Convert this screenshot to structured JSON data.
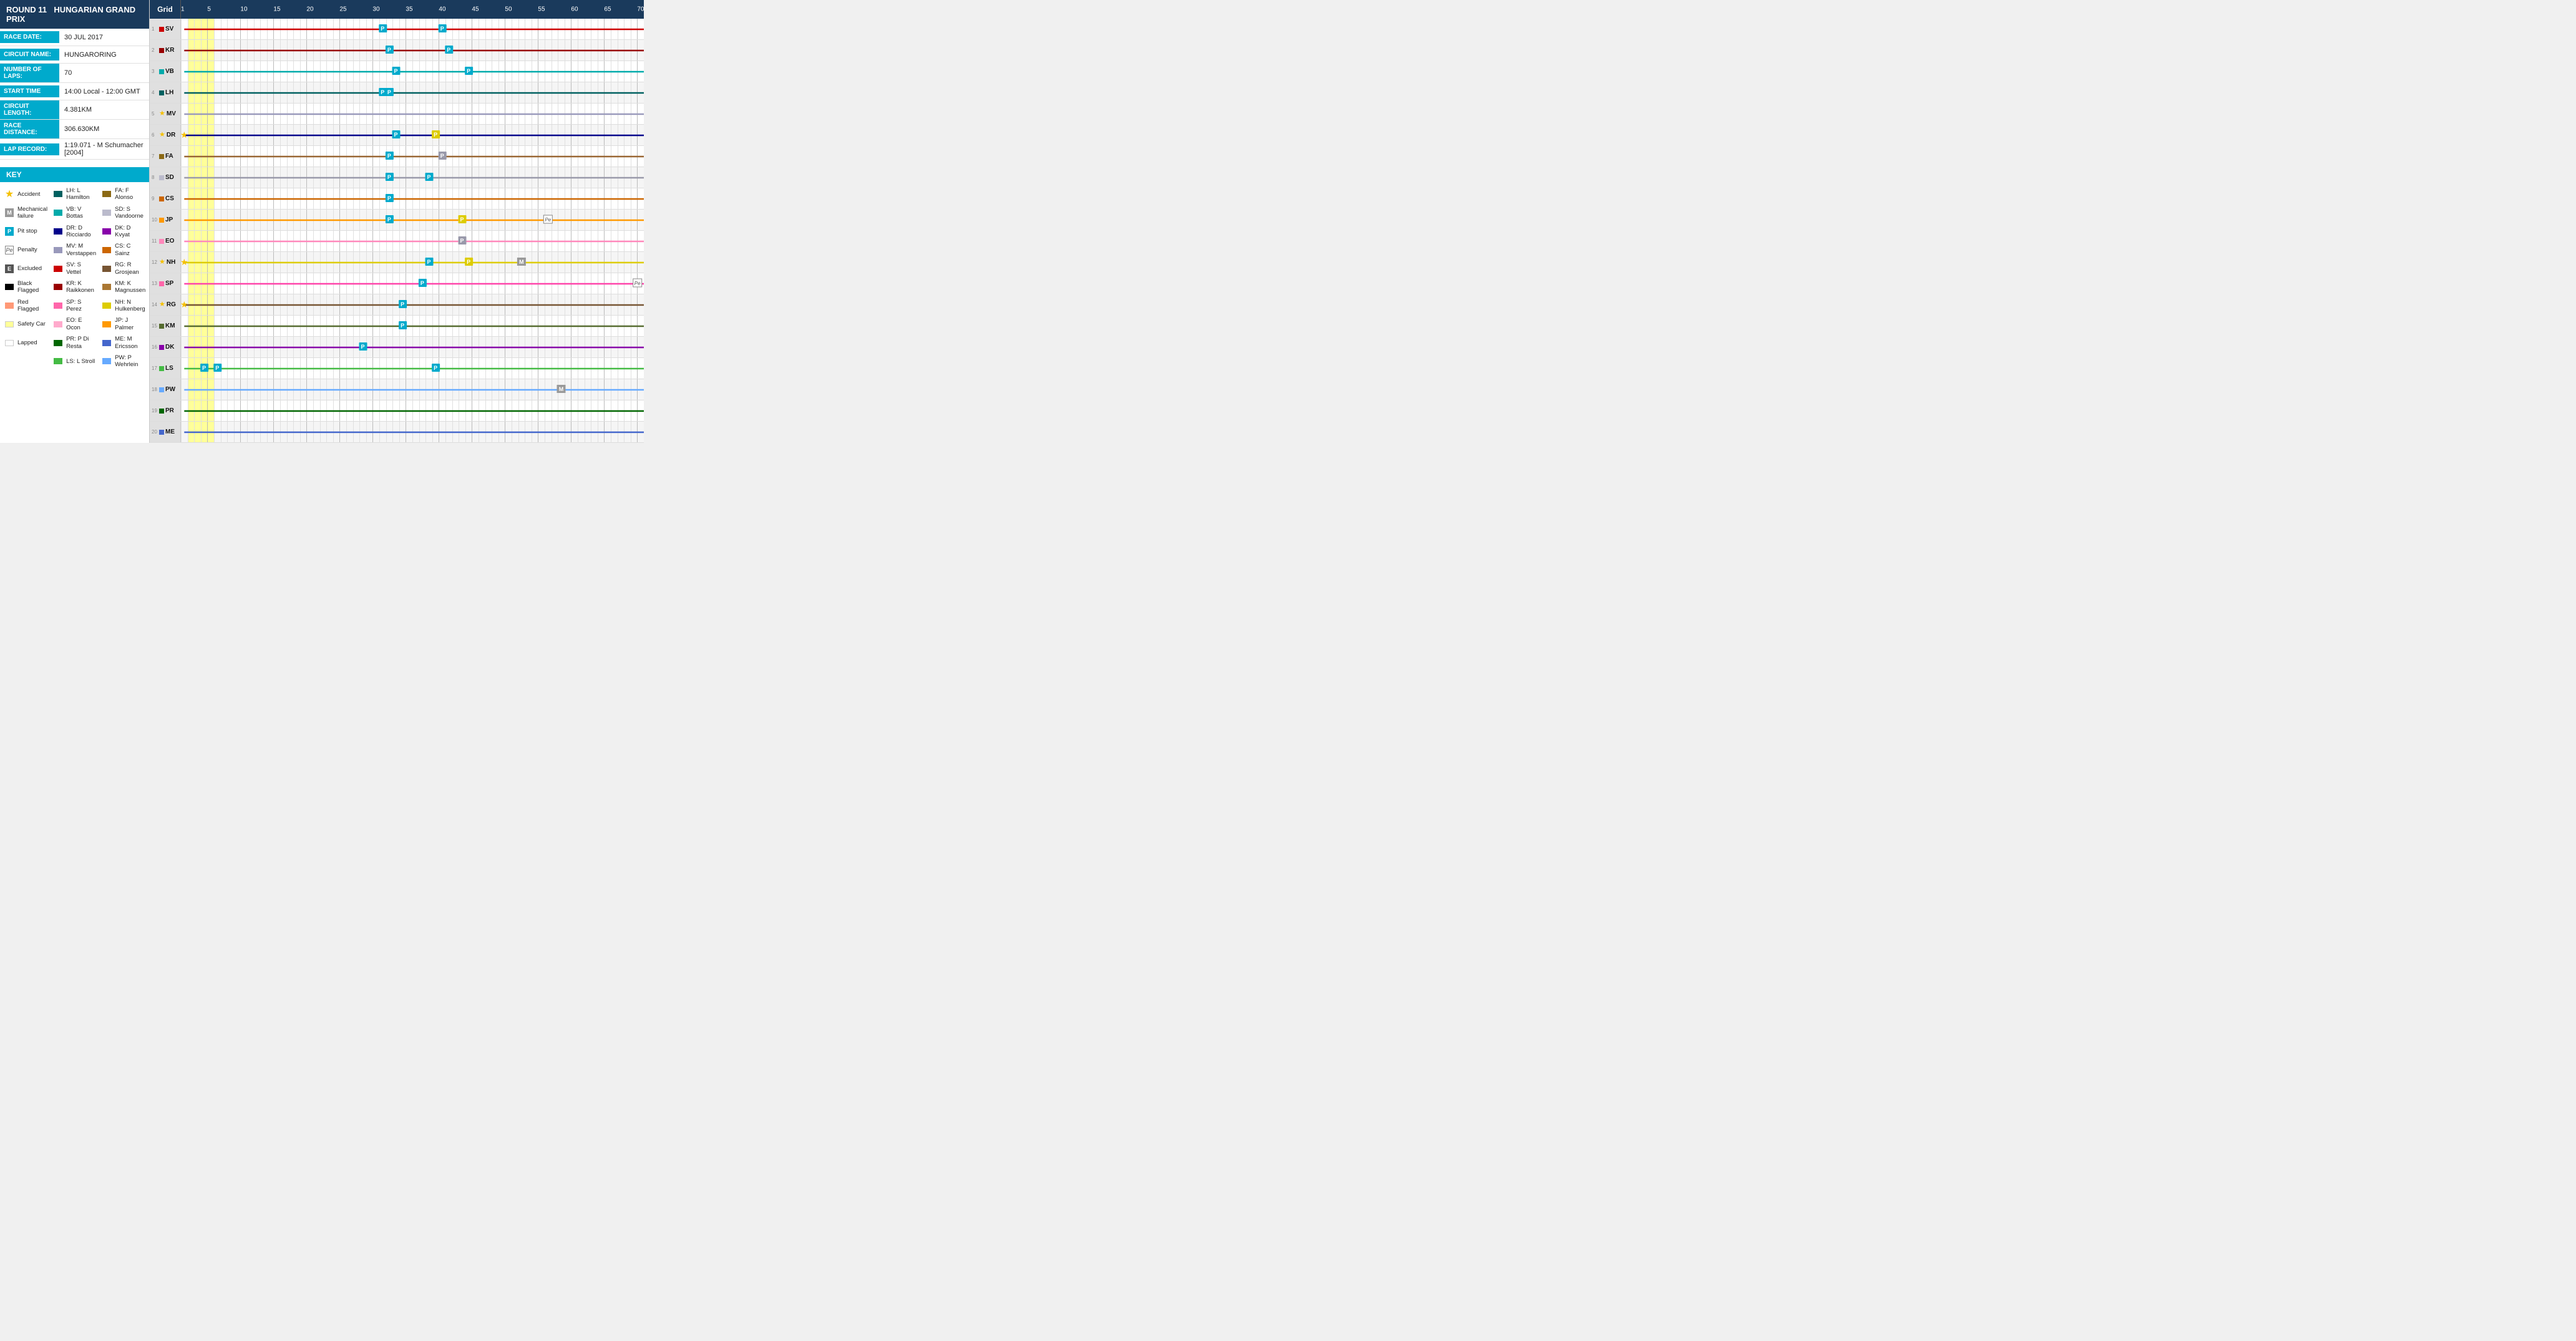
{
  "left": {
    "round_label": "ROUND 11",
    "gp_name": "HUNGARIAN GRAND PRIX",
    "race_date_label": "RACE DATE:",
    "race_date_value": "30 JUL 2017",
    "circuit_name_label": "CIRCUIT NAME:",
    "circuit_name_value": "HUNGARORING",
    "num_laps_label": "NUMBER OF LAPS:",
    "num_laps_value": "70",
    "start_time_label": "START TIME",
    "start_time_value": "14:00 Local - 12:00 GMT",
    "circuit_length_label": "CIRCUIT LENGTH:",
    "circuit_length_value": "4.381KM",
    "race_distance_label": "RACE DISTANCE:",
    "race_distance_value": "306.630KM",
    "lap_record_label": "LAP RECORD:",
    "lap_record_value": "1:19.071 - M Schumacher [2004]",
    "key_label": "KEY",
    "key_items": [
      {
        "icon": "accident",
        "label": "Accident"
      },
      {
        "icon": "mechanical",
        "label": "Mechanical failure"
      },
      {
        "icon": "pitstop",
        "label": "Pit stop"
      },
      {
        "icon": "penalty",
        "label": "Penalty"
      },
      {
        "icon": "excluded",
        "label": "Excluded"
      },
      {
        "icon": "blackflag",
        "label": "Black Flagged"
      },
      {
        "icon": "redflag",
        "label": "Red Flagged"
      },
      {
        "icon": "safetycar",
        "label": "Safety Car"
      },
      {
        "icon": "lapped",
        "label": "Lapped"
      }
    ],
    "driver_keys": [
      {
        "color": "#006060",
        "code": "LH",
        "name": "L Hamilton"
      },
      {
        "color": "#00cccc",
        "code": "VB",
        "name": "V Bottas"
      },
      {
        "color": "#00008b",
        "code": "DR",
        "name": "D Ricciardo"
      },
      {
        "color": "#9999cc",
        "code": "MV",
        "name": "M Verstappen"
      },
      {
        "color": "#cc0000",
        "code": "SV",
        "name": "S Vettel"
      },
      {
        "color": "#990000",
        "code": "KR",
        "name": "K Raikkonen"
      },
      {
        "color": "#ff66aa",
        "code": "SP",
        "name": "S Perez"
      },
      {
        "color": "#ffaacc",
        "code": "EO",
        "name": "E Ocon"
      },
      {
        "color": "#006600",
        "code": "PR",
        "name": "P Di Resta"
      },
      {
        "color": "#44bb44",
        "code": "LS",
        "name": "L Stroll"
      },
      {
        "color": "#8b6914",
        "code": "FA",
        "name": "F Alonso"
      },
      {
        "color": "#bbbbcc",
        "code": "SD",
        "name": "S Vandoorne"
      },
      {
        "color": "#8800aa",
        "code": "DK",
        "name": "D Kvyat"
      },
      {
        "color": "#cc6600",
        "code": "CS",
        "name": "C Sainz"
      },
      {
        "color": "#775533",
        "code": "RG",
        "name": "R Grosjean"
      },
      {
        "color": "#aa7733",
        "code": "KM",
        "name": "K Magnussen"
      },
      {
        "color": "#ddcc00",
        "code": "NH",
        "name": "N Hulkenberg"
      },
      {
        "color": "#ff9900",
        "code": "JP",
        "name": "J Palmer"
      },
      {
        "color": "#4466cc",
        "code": "ME",
        "name": "M Ericsson"
      },
      {
        "color": "#66aaff",
        "code": "PW",
        "name": "P Wehrlein"
      }
    ]
  },
  "chart": {
    "grid_label": "Grid",
    "total_laps": 70,
    "lap_markers": [
      1,
      5,
      10,
      15,
      20,
      25,
      30,
      35,
      40,
      45,
      50,
      55,
      60,
      65,
      70
    ],
    "safety_car_laps": [
      [
        2,
        5
      ]
    ],
    "drivers": [
      {
        "pos": 1,
        "code": "SV",
        "color": "#cc0000",
        "badge": "square"
      },
      {
        "pos": 2,
        "code": "KR",
        "color": "#990000",
        "badge": "square"
      },
      {
        "pos": 3,
        "code": "VB",
        "color": "#00aaaa",
        "badge": "square"
      },
      {
        "pos": 4,
        "code": "LH",
        "color": "#006060",
        "badge": "square"
      },
      {
        "pos": 5,
        "code": "MV",
        "color": "#9999bb",
        "badge": "star"
      },
      {
        "pos": 6,
        "code": "DR",
        "color": "#00008b",
        "badge": "star"
      },
      {
        "pos": 7,
        "code": "FA",
        "color": "#8b6914",
        "badge": "square"
      },
      {
        "pos": 8,
        "code": "SD",
        "color": "#bbbbcc",
        "badge": "square"
      },
      {
        "pos": 9,
        "code": "CS",
        "color": "#cc6600",
        "badge": "square"
      },
      {
        "pos": 10,
        "code": "JP",
        "color": "#ff9900",
        "badge": "square"
      },
      {
        "pos": 11,
        "code": "EO",
        "color": "#ff88bb",
        "badge": "square"
      },
      {
        "pos": 12,
        "code": "NH",
        "color": "#ddcc00",
        "badge": "star"
      },
      {
        "pos": 13,
        "code": "SP",
        "color": "#ff66aa",
        "badge": "square"
      },
      {
        "pos": 14,
        "code": "RG",
        "color": "#775533",
        "badge": "star"
      },
      {
        "pos": 15,
        "code": "KM",
        "color": "#556b2f",
        "badge": "square"
      },
      {
        "pos": 16,
        "code": "DK",
        "color": "#8800aa",
        "badge": "square"
      },
      {
        "pos": 17,
        "code": "LS",
        "color": "#44bb44",
        "badge": "square"
      },
      {
        "pos": 18,
        "code": "PW",
        "color": "#66aaff",
        "badge": "square"
      },
      {
        "pos": 19,
        "code": "PR",
        "color": "#006600",
        "badge": "square"
      },
      {
        "pos": 20,
        "code": "ME",
        "color": "#4466cc",
        "badge": "square"
      }
    ]
  }
}
